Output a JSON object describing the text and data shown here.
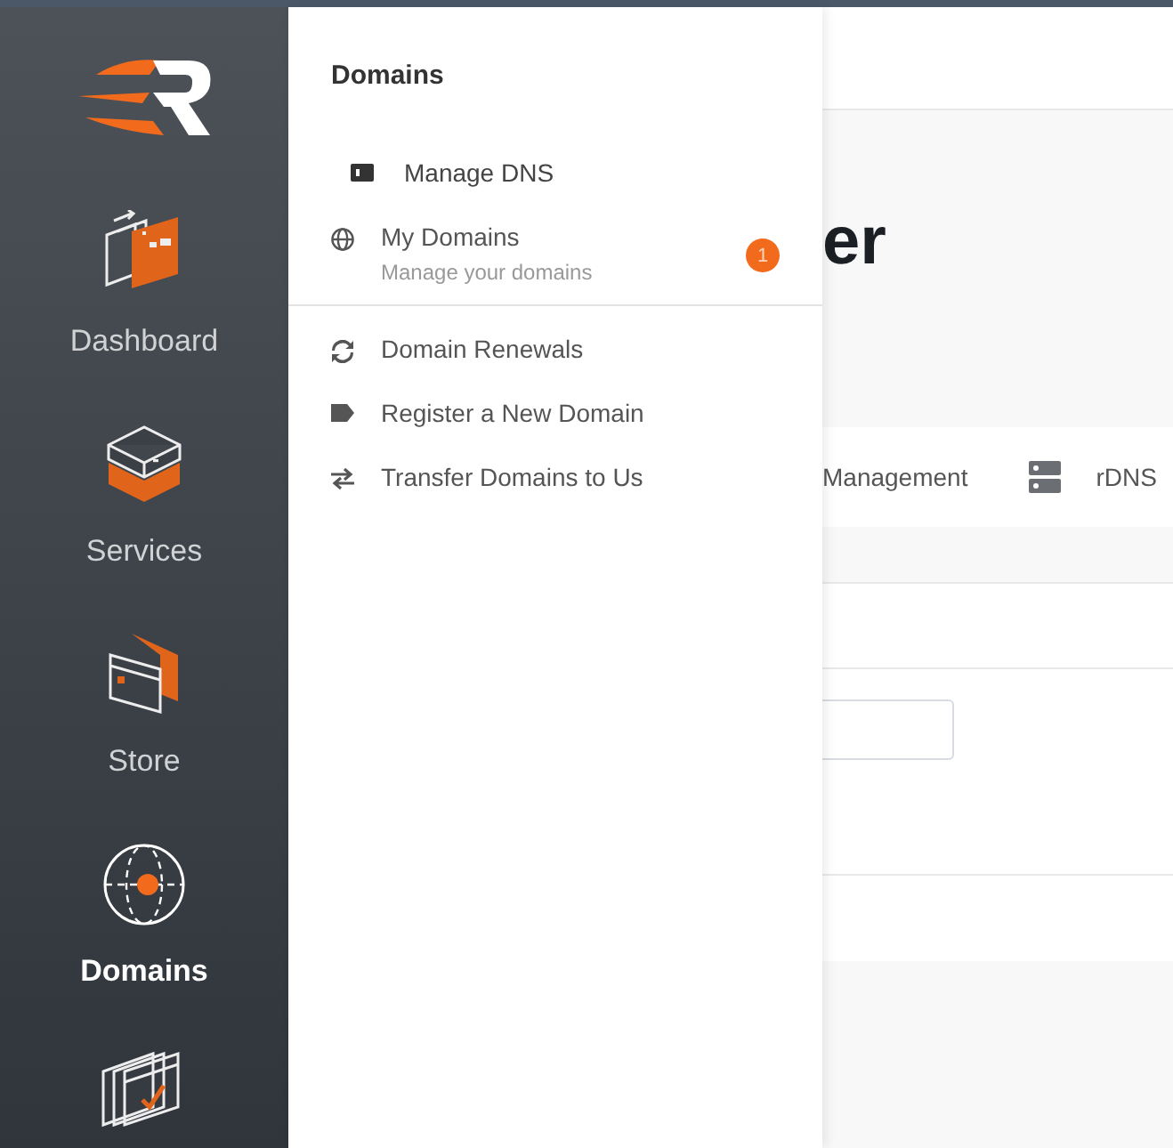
{
  "sidebar": {
    "items": [
      {
        "kind": "dashboard",
        "label": "Dashboard",
        "selected": false
      },
      {
        "kind": "services",
        "label": "Services",
        "selected": false
      },
      {
        "kind": "store",
        "label": "Store",
        "selected": false
      },
      {
        "kind": "domains",
        "label": "Domains",
        "selected": true
      },
      {
        "kind": "documents",
        "selected": false
      }
    ]
  },
  "flyout": {
    "title": "Domains",
    "groups": [
      [
        {
          "kind": "card",
          "label": "Manage DNS",
          "hovered": true
        },
        {
          "kind": "globe",
          "label": "My Domains",
          "subtitle": "Manage your domains",
          "badge": "1",
          "hovered": false
        }
      ],
      [
        {
          "kind": "renew",
          "label": "Domain Renewals",
          "hovered": false
        },
        {
          "kind": "tag",
          "label": "Register a New Domain",
          "hovered": false
        },
        {
          "kind": "transfer",
          "label": "Transfer Domains to Us",
          "hovered": false
        }
      ]
    ]
  },
  "main": {
    "heading": "er",
    "tabs": [
      {
        "label": "Management"
      },
      {
        "kind": "server",
        "label": "rDNS"
      }
    ]
  }
}
